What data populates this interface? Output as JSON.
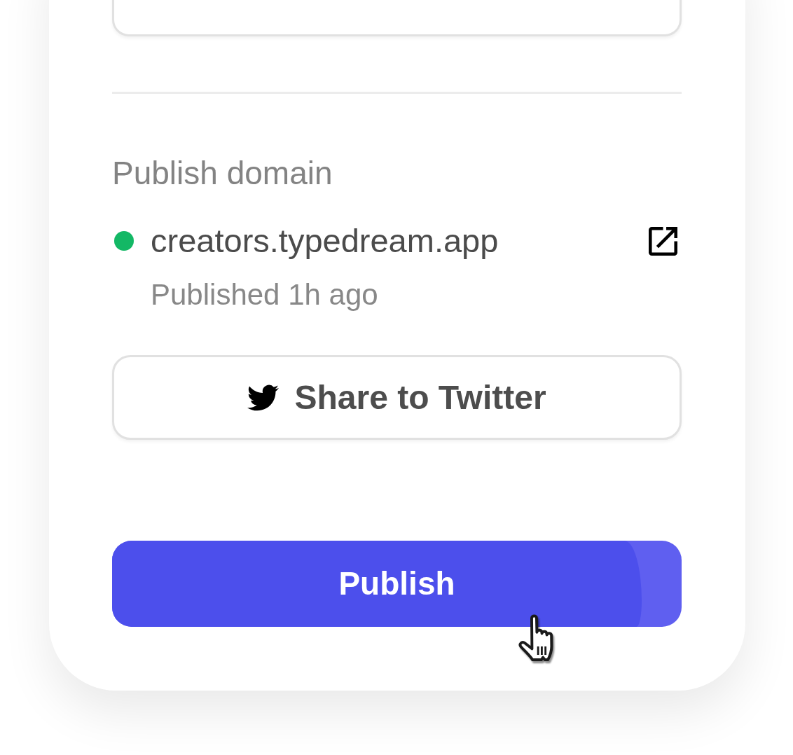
{
  "section": {
    "title": "Publish domain"
  },
  "domain": {
    "url": "creators.typedream.app",
    "live": true,
    "published": "Published 1h ago"
  },
  "share_button": {
    "label": "Share to Twitter"
  },
  "publish_button": {
    "label": "Publish",
    "level": 0.93
  }
}
